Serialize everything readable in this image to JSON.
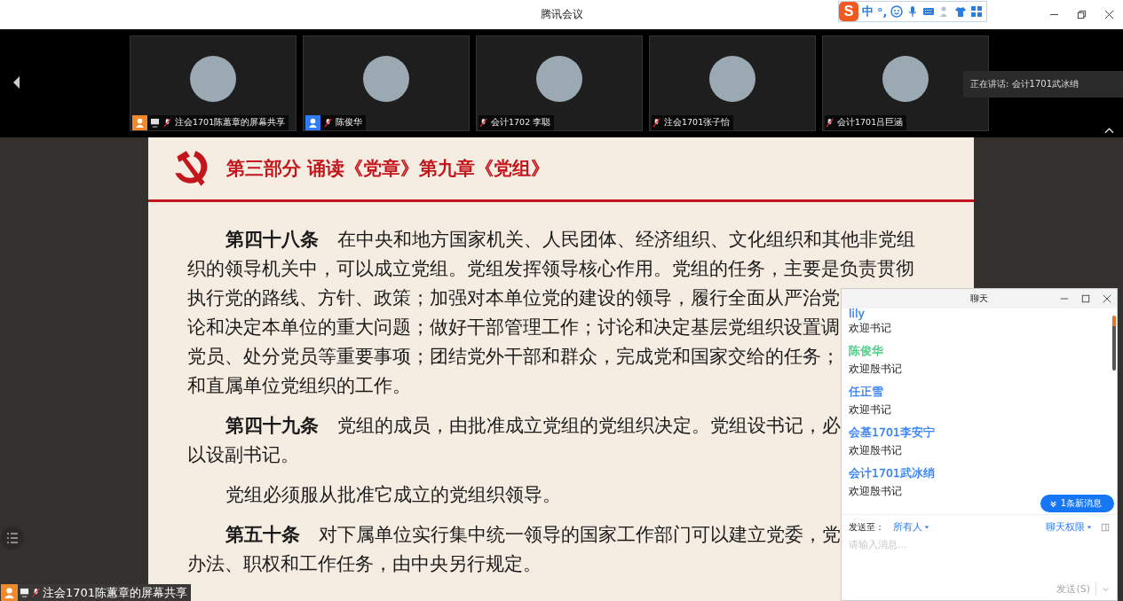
{
  "window": {
    "title": "腾讯会议"
  },
  "ime_toolbar": {
    "logo": "S",
    "mode": "中",
    "punct": "°,"
  },
  "video_strip": {
    "tiles": [
      {
        "name": "注会1701陈蕙章的屏幕共享",
        "kind": "sharing"
      },
      {
        "name": "陈俊华",
        "kind": "guest"
      },
      {
        "name": "会计1702 李聪",
        "kind": "member"
      },
      {
        "name": "注会1701张子怡",
        "kind": "member"
      },
      {
        "name": "会计1701吕巨涵",
        "kind": "member"
      }
    ],
    "speaking": "正在讲话: 会计1701武冰绡"
  },
  "slide": {
    "heading": "第三部分 诵读《党章》第九章《党组》",
    "paragraphs": [
      [
        "**第四十八条**　在中央和地方国家机关、人民团体、经济组织、文化组织和其他非党组",
        "织的领导机关中，可以成立党组。党组发挥领导核心作用。党组的任务，主要是负责贯彻",
        "执行党的路线、方针、政策；加强对本单位党的建设的领导，履行全面从严治党",
        "论和决定本单位的重大问题；做好干部管理工作；讨论和决定基层党组织设置调",
        "党员、处分党员等重要事项；团结党外干部和群众，完成党和国家交给的任务；",
        "和直属单位党组织的工作。"
      ],
      [
        "**第四十九条**　党组的成员，由批准成立党组的党组织决定。党组设书记，必",
        "以设副书记。"
      ],
      [
        "党组必须服从批准它成立的党组织领导。"
      ],
      [
        "**第五十条**　对下属单位实行集中统一领导的国家工作部门可以建立党委，党",
        "办法、职权和工作任务，由中央另行规定。"
      ]
    ]
  },
  "share_label": "注会1701陈蕙章的屏幕共享",
  "chat": {
    "title": "聊天",
    "messages": [
      {
        "sender": "lily",
        "color": "#2f7cf6",
        "text": "欢迎书记"
      },
      {
        "sender": "陈俊华",
        "color": "#3dc97c",
        "text": "欢迎殷书记"
      },
      {
        "sender": "任正雪",
        "color": "#2f7cf6",
        "text": "欢迎书记"
      },
      {
        "sender": "会基1701李安宁",
        "color": "#2f7cf6",
        "text": "欢迎殷书记"
      },
      {
        "sender": "会计1701武冰绡",
        "color": "#2f7cf6",
        "text": "欢迎殷书记"
      }
    ],
    "new_messages": "1条新消息",
    "send_to_label": "发送至：",
    "send_to": "所有人",
    "permission": "聊天权限",
    "placeholder": "请输入消息...",
    "send_button": "发送(S)"
  }
}
